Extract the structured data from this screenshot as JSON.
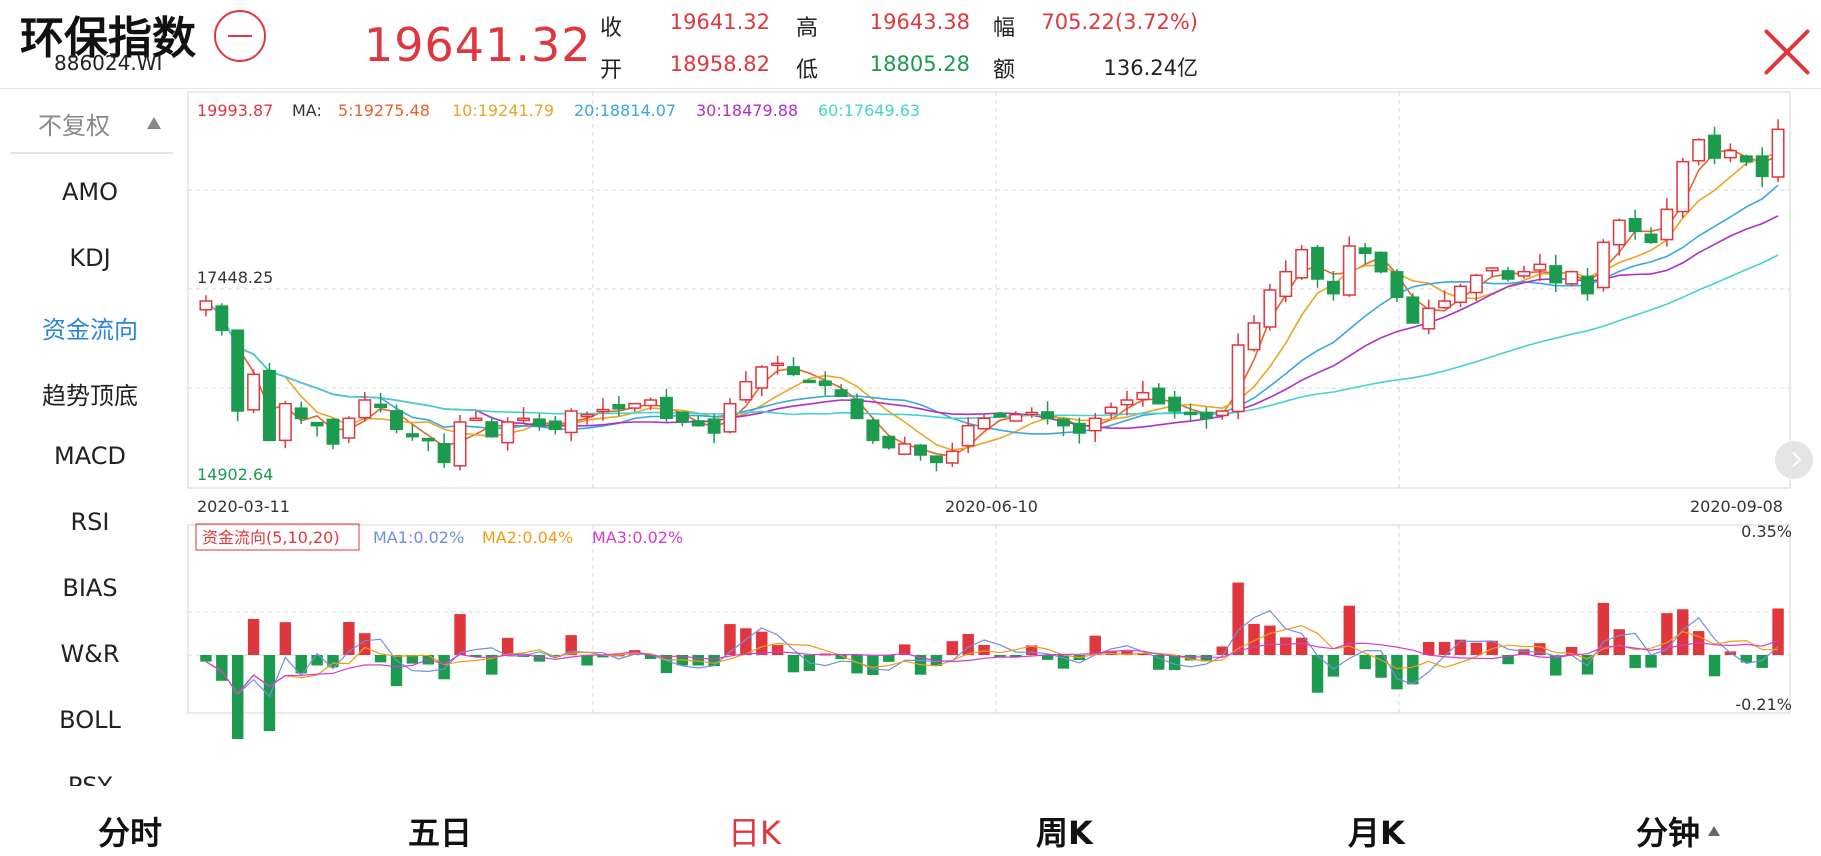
{
  "header": {
    "title": "环保指数",
    "code": "886024.WI",
    "price": "19641.32",
    "stats": {
      "close_label": "收",
      "close_value": "19641.32",
      "high_label": "高",
      "high_value": "19643.38",
      "range_label": "幅",
      "range_value": "705.22(3.72%)",
      "open_label": "开",
      "open_value": "18958.82",
      "low_label": "低",
      "low_value": "18805.28",
      "amount_label": "额",
      "amount_value": "136.24亿"
    }
  },
  "sidebar": {
    "adjust_label": "不复权",
    "items": [
      "AMO",
      "KDJ",
      "资金流向",
      "趋势顶底",
      "MACD",
      "RSI",
      "BIAS",
      "W&R",
      "BOLL",
      "PSY"
    ],
    "active_index": 2
  },
  "tabs": {
    "items": [
      "分时",
      "五日",
      "日K",
      "周K",
      "月K",
      "分钟"
    ],
    "active_index": 2
  },
  "colors": {
    "up": "#e0363e",
    "down": "#1c9a4e",
    "ma5": "#e8622c",
    "ma10": "#eaa624",
    "ma20": "#3aa7e0",
    "ma30": "#b02fc9",
    "ma60": "#44d2d4",
    "mfi_ma1": "#6f8fe0",
    "mfi_ma2": "#f39c12",
    "mfi_ma3": "#d33bd3"
  },
  "main_chart": {
    "top_value": "19993.87",
    "ma_label": "MA:",
    "ma5": "5:19275.48",
    "ma10": "10:19241.79",
    "ma20": "20:18814.07",
    "ma30": "30:18479.88",
    "ma60": "60:17649.63",
    "marker_high": "17448.25",
    "marker_low": "14902.64",
    "dates": [
      "2020-03-11",
      "2020-06-10",
      "2020-09-08"
    ]
  },
  "sub_chart": {
    "name": "资金流向(5,10,20)",
    "ma1": "MA1:0.02%",
    "ma2": "MA2:0.04%",
    "ma3": "MA3:0.02%",
    "max_label": "0.35%",
    "min_label": "-0.21%"
  },
  "chart_data": {
    "type": "candlestick",
    "y_range": [
      14750,
      20150
    ],
    "closes": [
      17300,
      16900,
      15800,
      16300,
      15400,
      15900,
      15700,
      15600,
      15350,
      15700,
      15950,
      15850,
      15550,
      15450,
      15400,
      15100,
      15650,
      15700,
      15450,
      15650,
      15700,
      15600,
      15550,
      15800,
      15750,
      15820,
      15830,
      15900,
      15950,
      15700,
      15650,
      15600,
      15500,
      15900,
      16200,
      16400,
      16450,
      16300,
      16200,
      16150,
      16000,
      15700,
      15400,
      15300,
      15350,
      15200,
      15100,
      15250,
      15600,
      15700,
      15720,
      15750,
      15780,
      15700,
      15600,
      15500,
      15700,
      15850,
      15950,
      16050,
      15900,
      15800,
      15780,
      15700,
      15800,
      16700,
      17000,
      17450,
      17700,
      18000,
      17600,
      17400,
      18050,
      17950,
      17700,
      17350,
      17000,
      17200,
      17300,
      17500,
      17650,
      17750,
      17600,
      17700,
      17800,
      17550,
      17700,
      17400,
      18100,
      18400,
      18250,
      18100,
      18550,
      19200,
      19500,
      19250,
      19350,
      19200,
      19000,
      19641
    ]
  }
}
